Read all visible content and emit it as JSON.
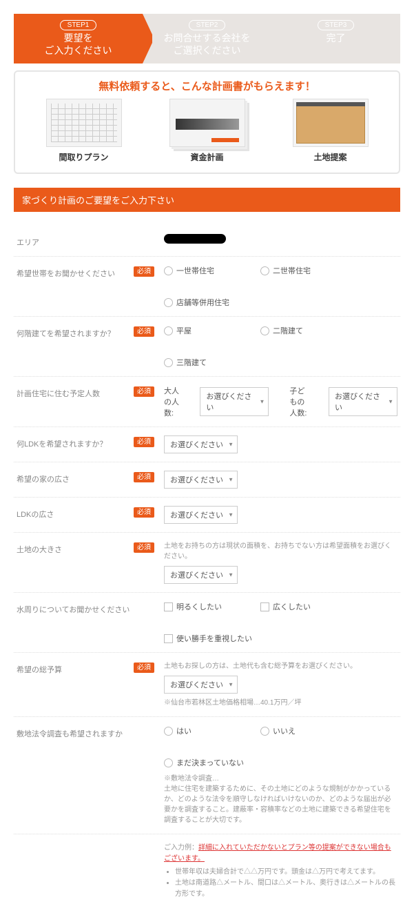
{
  "steps": [
    {
      "label": "STEP1",
      "line1": "要望を",
      "line2": "ご入力ください"
    },
    {
      "label": "STEP2",
      "line1": "お問合せする会社を",
      "line2": "ご選択ください"
    },
    {
      "label": "STEP3",
      "line1": "完了",
      "line2": ""
    }
  ],
  "promo": {
    "title": "無料依頼すると、こんな計画書がもらえます！",
    "items": [
      "間取りプラン",
      "資金計画",
      "土地提案"
    ]
  },
  "form_header": "家づくり計画のご要望をご入力下さい",
  "badge": "必須",
  "labels": {
    "area": "エリア",
    "household": "希望世帯をお聞かせください",
    "floors": "何階建てを希望されますか？",
    "people": "計画住宅に住む予定人数",
    "ldk_num": "何LDKを希望されますか？",
    "house_size": "希望の家の広さ",
    "ldk_size": "LDKの広さ",
    "land_size": "土地の大きさ",
    "water": "水周りについてお聞かせください",
    "budget": "希望の総予算",
    "survey": "敷地法令調査も希望されますか"
  },
  "household_opts": [
    "一世帯住宅",
    "二世帯住宅",
    "店舗等併用住宅"
  ],
  "floor_opts": [
    "平屋",
    "二階建て",
    "三階建て"
  ],
  "people": {
    "adult": "大人の人数:",
    "child": "子どもの人数:"
  },
  "select_placeholder": "お選びください",
  "land_note": "土地をお持ちの方は現状の面積を、お持ちでない方は希望面積をお選びください。",
  "water_opts": [
    "明るくしたい",
    "広くしたい",
    "使い勝手を重視したい"
  ],
  "budget_note_top": "土地もお探しの方は、土地代も含む総予算をお選びください。",
  "budget_note_bot": "※仙台市若林区土地価格相場…40.1万円／坪",
  "survey_opts": [
    "はい",
    "いいえ",
    "まだ決まっていない"
  ],
  "survey_note": "※敷地法令調査…\n土地に住宅を建築するために、その土地にどのような規制がかかっているか、どのような法令を順守しなければいけないのか、どのような届出が必要かを調査すること。建蔽率・容積率などの土地に建築できる希望住宅を調査することが大切です。",
  "example": {
    "head": "ご入力例：",
    "red": "詳細に入れていただかないとプラン等の提案ができない場合もございます。",
    "b1": "世帯年収は夫婦合計で△△万円です。頭金は△万円で考えてます。",
    "b2": "土地は南道路△メートル、間口は△メートル、奥行きは△メートルの長方形です。"
  }
}
